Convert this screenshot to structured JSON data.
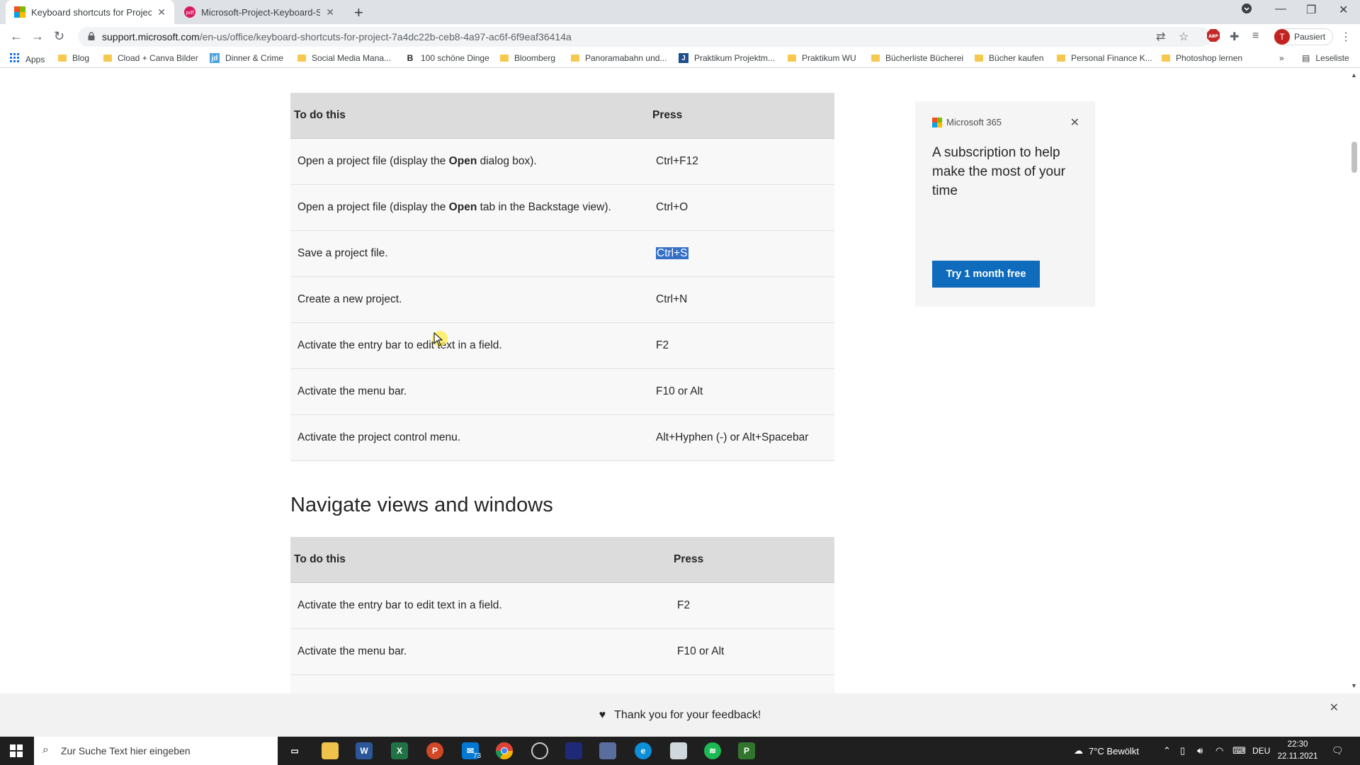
{
  "tabs": [
    {
      "title": "Keyboard shortcuts for Project"
    },
    {
      "title": "Microsoft-Project-Keyboard-Sho"
    }
  ],
  "address": {
    "host": "support.microsoft.com",
    "path": "/en-us/office/keyboard-shortcuts-for-project-7a4dc22b-ceb8-4a97-ac6f-6f9eaf36414a"
  },
  "profile": {
    "initial": "T",
    "label": "Pausiert"
  },
  "bookmarks": [
    {
      "label": "Apps"
    },
    {
      "label": "Blog"
    },
    {
      "label": "Cload + Canva Bilder"
    },
    {
      "label": "Dinner & Crime"
    },
    {
      "label": "Social Media Mana..."
    },
    {
      "label": "100 schöne Dinge"
    },
    {
      "label": "Bloomberg"
    },
    {
      "label": "Panoramabahn und..."
    },
    {
      "label": "Praktikum Projektm..."
    },
    {
      "label": "Praktikum WU"
    },
    {
      "label": "Bücherliste Bücherei"
    },
    {
      "label": "Bücher kaufen"
    },
    {
      "label": "Personal Finance K..."
    },
    {
      "label": "Photoshop lernen"
    },
    {
      "label": "Leseliste"
    }
  ],
  "table1": {
    "head": {
      "action": "To do this",
      "keys": "Press"
    },
    "rows": [
      {
        "pre": "Open a project file (display the ",
        "bold": "Open",
        "post": " dialog box).",
        "keys": "Ctrl+F12"
      },
      {
        "pre": "Open a project file (display the ",
        "bold": "Open",
        "post": " tab in the Backstage view).",
        "keys": "Ctrl+O"
      },
      {
        "pre": "Save a project file.",
        "bold": "",
        "post": "",
        "keys": "Ctrl+S"
      },
      {
        "pre": "Create a new project.",
        "bold": "",
        "post": "",
        "keys": "Ctrl+N"
      },
      {
        "pre": "Activate the entry bar to edit text in a field.",
        "bold": "",
        "post": "",
        "keys": "F2"
      },
      {
        "pre": "Activate the menu bar.",
        "bold": "",
        "post": "",
        "keys": "F10 or Alt"
      },
      {
        "pre": "Activate the project control menu.",
        "bold": "",
        "post": "",
        "keys": "Alt+Hyphen (-) or Alt+Spacebar"
      }
    ]
  },
  "section2": {
    "heading": "Navigate views and windows"
  },
  "table2": {
    "head": {
      "action": "To do this",
      "keys": "Press"
    },
    "rows": [
      {
        "action": "Activate the entry bar to edit text in a field.",
        "keys": "F2"
      },
      {
        "action": "Activate the menu bar.",
        "keys": "F10 or Alt"
      }
    ]
  },
  "ad": {
    "brand": "Microsoft 365",
    "copy": "A subscription to help make the most of your time",
    "cta": "Try 1 month free"
  },
  "feedback": {
    "text": "Thank you for your feedback!"
  },
  "taskbar": {
    "search_placeholder": "Zur Suche Text hier eingeben",
    "mail_badge": "73",
    "weather": "7°C  Bewölkt",
    "lang": "DEU",
    "time": "22:30",
    "date": "22.11.2021"
  }
}
